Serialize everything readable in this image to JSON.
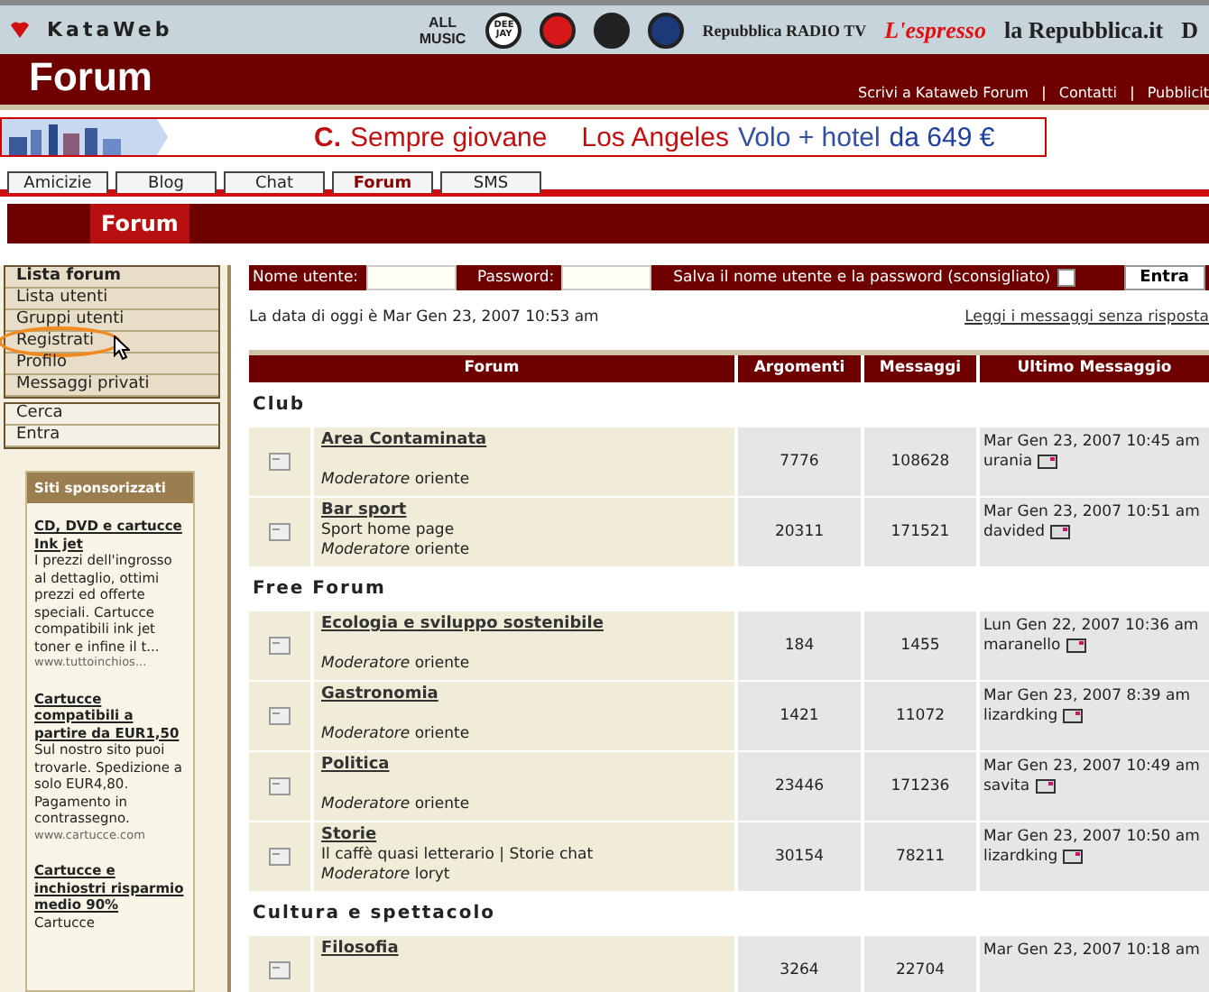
{
  "top_bar": {
    "brand": "KataWeb",
    "partner_logos": [
      {
        "text": "ALL MUSIC",
        "kind": "text"
      },
      {
        "text": "DEE JAY",
        "kind": "round"
      },
      {
        "kind": "redround"
      },
      {
        "kind": "darkround"
      },
      {
        "text": "Repubblica RADIO TV",
        "kind": "radio"
      },
      {
        "text": "L'espresso",
        "kind": "espresso"
      },
      {
        "text": "la Repubblica.it",
        "kind": "serif"
      },
      {
        "text": "D",
        "kind": "serif"
      }
    ]
  },
  "header": {
    "title": "Forum",
    "links": [
      {
        "kind": "link",
        "text": "Scrivi a Kataweb Forum"
      },
      {
        "kind": "separator",
        "text": "|"
      },
      {
        "kind": "link",
        "text": "Contatti"
      },
      {
        "kind": "separator",
        "text": "|"
      },
      {
        "kind": "link",
        "text": "Pubblicit"
      }
    ]
  },
  "banner": {
    "parts": [
      "C.",
      "Sempre giovane",
      "Los Angeles",
      "Volo + hotel",
      "da 649 €"
    ]
  },
  "tabs": [
    {
      "label": "Amicizie",
      "selected": false
    },
    {
      "label": "Blog",
      "selected": false
    },
    {
      "label": "Chat",
      "selected": false
    },
    {
      "label": "Forum",
      "selected": true
    },
    {
      "label": "SMS",
      "selected": false
    }
  ],
  "section_title": "Forum",
  "sidebar": {
    "menu": [
      {
        "label": "Lista forum",
        "selected": true,
        "circled": false
      },
      {
        "label": "Lista utenti",
        "selected": false,
        "circled": false
      },
      {
        "label": "Gruppi utenti",
        "selected": false,
        "circled": false
      },
      {
        "label": "Registrati",
        "selected": false,
        "circled": true
      },
      {
        "label": "Profilo",
        "selected": false,
        "circled": false
      },
      {
        "label": "Messaggi privati",
        "selected": false,
        "circled": false
      }
    ],
    "menu2": [
      "Cerca",
      "Entra"
    ],
    "sponsored": {
      "title": "Siti sponsorizzati",
      "ads": [
        {
          "title": "CD, DVD e cartucce Ink jet",
          "body": "I prezzi dell'ingrosso al dettaglio, ottimi prezzi ed offerte speciali. Cartucce compatibili ink jet toner e infine il t...",
          "url": "www.tuttoinchios..."
        },
        {
          "title": "Cartucce compatibili a partire da EUR1,50",
          "body": "Sul nostro sito puoi trovarle. Spedizione a solo EUR4,80. Pagamento in contrassegno.",
          "url": "www.cartucce.com"
        },
        {
          "title": "Cartucce e inchiostri risparmio medio 90%",
          "body": "Cartucce"
        }
      ]
    }
  },
  "login": {
    "user_label": "Nome utente:",
    "password_label": "Password:",
    "remember_label": "Salva il nome utente e la password (sconsigliato)",
    "remember_checked": false,
    "button": "Entra"
  },
  "date_text": "La data di oggi è Mar Gen 23, 2007 10:53 am",
  "unanswered_link": "Leggi i messaggi senza risposta",
  "table": {
    "columns": [
      "Forum",
      "Argomenti",
      "Messaggi",
      "Ultimo Messaggio"
    ],
    "categories": [
      {
        "name": "Club",
        "forums": [
          {
            "name": "Area Contaminata",
            "moderator_label": "Moderatore",
            "moderator": "oriente",
            "topics": "7776",
            "posts": "108628",
            "last_date": "Mar Gen 23, 2007 10:45 am",
            "last_user": "urania"
          },
          {
            "name": "Bar sport",
            "description": "Sport home page",
            "moderator_label": "Moderatore",
            "moderator": "oriente",
            "topics": "20311",
            "posts": "171521",
            "last_date": "Mar Gen 23, 2007 10:51 am",
            "last_user": "davided"
          }
        ]
      },
      {
        "name": "Free Forum",
        "forums": [
          {
            "name": "Ecologia e sviluppo sostenibile",
            "moderator_label": "Moderatore",
            "moderator": "oriente",
            "topics": "184",
            "posts": "1455",
            "last_date": "Lun Gen 22, 2007 10:36 am",
            "last_user": "maranello"
          },
          {
            "name": "Gastronomia",
            "moderator_label": "Moderatore",
            "moderator": "oriente",
            "topics": "1421",
            "posts": "11072",
            "last_date": "Mar Gen 23, 2007 8:39 am",
            "last_user": "lizardking"
          },
          {
            "name": "Politica",
            "moderator_label": "Moderatore",
            "moderator": "oriente",
            "topics": "23446",
            "posts": "171236",
            "last_date": "Mar Gen 23, 2007 10:49 am",
            "last_user": "savita"
          },
          {
            "name": "Storie",
            "description": "Il caffè quasi letterario | Storie chat",
            "moderator_label": "Moderatore",
            "moderator": "loryt",
            "topics": "30154",
            "posts": "78211",
            "last_date": "Mar Gen 23, 2007 10:50 am",
            "last_user": "lizardking"
          }
        ]
      },
      {
        "name": "Cultura e spettacolo",
        "forums": [
          {
            "name": "Filosofia",
            "topics": "3264",
            "posts": "22704",
            "last_date": "Mar Gen 23, 2007 10:18 am"
          }
        ]
      }
    ]
  }
}
